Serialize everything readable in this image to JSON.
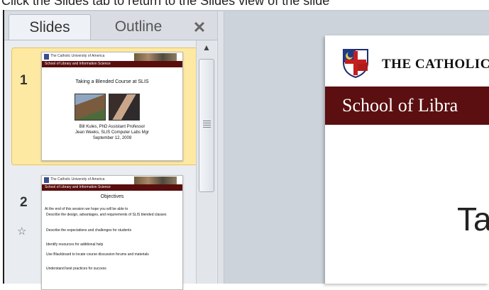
{
  "top_strip": {
    "text": "Click the Slides tab to return to the Slides view of the slide"
  },
  "tabs": {
    "slides": "Slides",
    "outline": "Outline",
    "close": "✕"
  },
  "thumbnails": [
    {
      "number": "1",
      "header": "The Catholic University of America",
      "band": "School of Library and Information Science",
      "title": "Taking a Blended Course at SLIS",
      "line1": "Bill Kules, PhD Assistant Professor",
      "line2": "Jean Weeks, SLIS Computer Labs Mgr",
      "line3": "September 12, 2009"
    },
    {
      "number": "2",
      "header": "The Catholic University of America",
      "band": "School of Library and Information Science",
      "title": "Objectives",
      "intro": "At the end of this session we hope you will be able to",
      "bullets": [
        "Describe the design, advantages, and requirements of SLIS blended classes",
        "Describe the expectations and challenges for students",
        "Identify resources for additional help",
        "Use Blackboard to locate course discussion forums and materials",
        "Understand best practices for success"
      ]
    }
  ],
  "slide": {
    "university": "THE CATHOLIC",
    "band": "School of Libra",
    "title": "Ta"
  },
  "colors": {
    "maroon": "#5b0f10",
    "selected": "#fde9a2"
  }
}
